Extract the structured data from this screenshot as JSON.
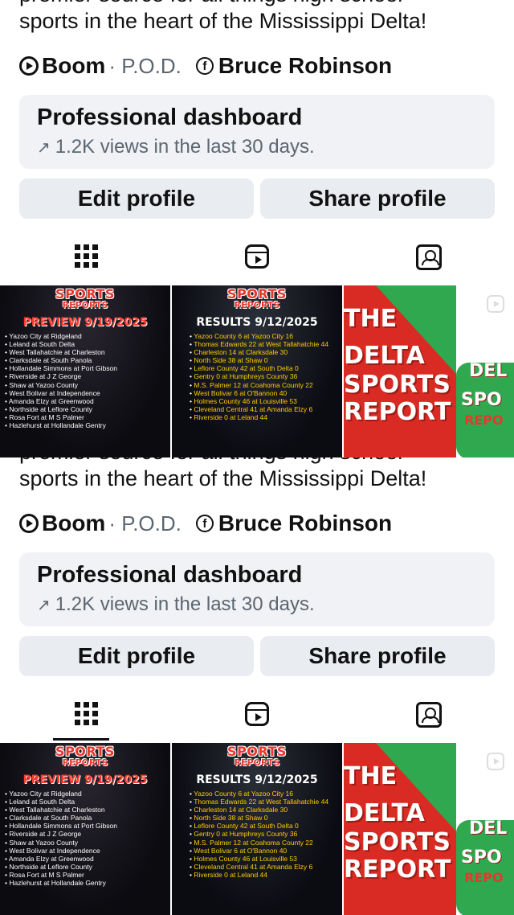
{
  "profile": {
    "bio_cut": "premier source for all things high school",
    "bio": "sports in the heart of the Mississippi Delta!",
    "links": {
      "music_label": "Boom",
      "music_artist": "· P.O.D.",
      "facebook_name": "Bruce Robinson",
      "facebook_glyph": "f"
    }
  },
  "dashboard": {
    "title": "Professional dashboard",
    "arrow": "↗",
    "subtitle": "1.2K views in the last 30 days."
  },
  "actions": {
    "edit_label": "Edit profile",
    "share_label": "Share profile"
  },
  "tabs": [
    {
      "name": "grid",
      "icon": "grid-icon",
      "selected": true
    },
    {
      "name": "reels",
      "icon": "reels-icon",
      "selected": false
    },
    {
      "name": "tagged",
      "icon": "tagged-icon",
      "selected": false
    }
  ],
  "posts": {
    "preview": {
      "logo_line1": "SPORTS",
      "logo_line2": "REPORTS",
      "heading": "PREVIEW 9/19/2025",
      "items": [
        "Yazoo City at Ridgeland",
        "Leland at South Delta",
        "West Tallahatchie at Charleston",
        "Clarksdale at South Panola",
        "Hollandale Simmons at Port Gibson",
        "Riverside at J Z George",
        "Shaw at Yazoo County",
        "West Bolivar at Independence",
        "Amanda Elzy at Greenwood",
        "Northside at Leflore County",
        "Rosa Fort at M S Palmer",
        "Hazlehurst at Hollandale Gentry"
      ]
    },
    "results": {
      "logo_line1": "SPORTS",
      "logo_line2": "REPORTS",
      "heading": "RESULTS 9/12/2025",
      "items": [
        "Yazoo County 6 at Yazoo City 16",
        "Thomas Edwards 22 at West Tallahatchie 44",
        "Charleston 14 at Clarksdale 30",
        "North Side 38 at Shaw 0",
        "Leflore County 42 at South Delta 0",
        "Gentry 0 at Humphreys County 36",
        "M.S. Palmer 12 at Coahoma County 22",
        "West Bolivar 6 at O'Bannon 40",
        "Holmes County 46 at Louisville 53",
        "Cleveland Central 41 at Amanda Elzy 6",
        "Riverside 0 at Leland 44"
      ]
    },
    "delta": {
      "line1": "THE",
      "line2": "DELTA",
      "line3": "SPORTS",
      "line4": "REPORT",
      "side1": "DEL",
      "side2": "SPO",
      "side3": "REPO"
    }
  }
}
